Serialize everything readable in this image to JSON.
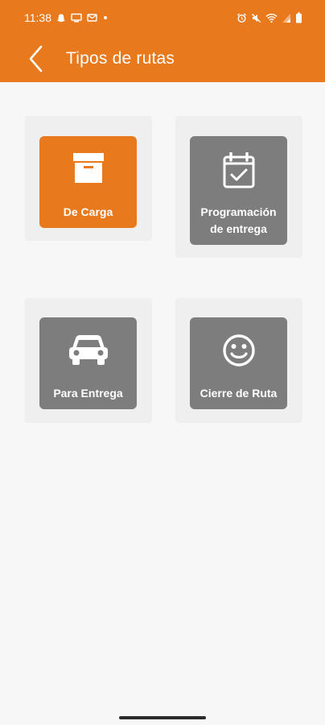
{
  "status_bar": {
    "time": "11:38",
    "left_icons": [
      "snapchat-icon",
      "screen-icon",
      "mail-icon",
      "dot-icon"
    ],
    "right_icons": [
      "alarm-icon",
      "mute-icon",
      "wifi-icon",
      "signal-icon",
      "battery-icon"
    ]
  },
  "header": {
    "title": "Tipos de rutas",
    "back_icon": "chevron-left-icon"
  },
  "colors": {
    "accent": "#e8791d",
    "tile_gray": "#7d7d7d",
    "card_bg": "#efefef",
    "page_bg": "#f7f7f7"
  },
  "tiles": [
    {
      "label": "De Carga",
      "icon": "archive-box-icon",
      "color": "#e8791d"
    },
    {
      "label": "Programación de entrega",
      "icon": "calendar-check-icon",
      "color": "#7d7d7d"
    },
    {
      "label": "Para Entrega",
      "icon": "car-icon",
      "color": "#7d7d7d"
    },
    {
      "label": "Cierre de Ruta",
      "icon": "smiley-icon",
      "color": "#7d7d7d"
    }
  ]
}
